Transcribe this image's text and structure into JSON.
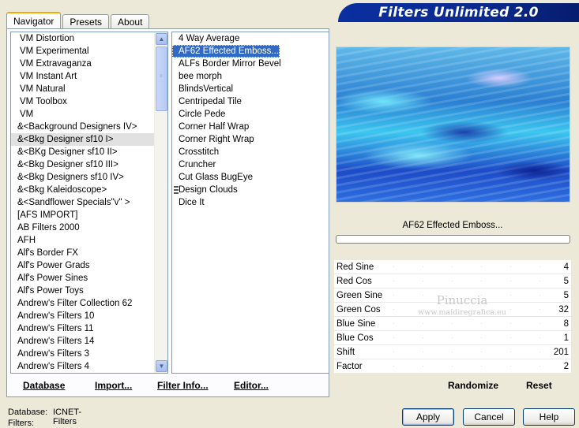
{
  "banner": {
    "title": "Filters Unlimited 2.0"
  },
  "tabs": [
    {
      "label": "Navigator"
    },
    {
      "label": "Presets"
    },
    {
      "label": "About"
    }
  ],
  "categories": [
    "VM Distortion",
    "VM Experimental",
    "VM Extravaganza",
    "VM Instant Art",
    "VM Natural",
    "VM Toolbox",
    "VM",
    "&<Background Designers IV>",
    "&<Bkg Designer sf10 I>",
    "&<BKg Designer sf10 II>",
    "&<Bkg Designer sf10 III>",
    "&<Bkg Designers sf10 IV>",
    "&<Bkg Kaleidoscope>",
    "&<Sandflower Specials\"v\" >",
    "[AFS IMPORT]",
    "AB Filters 2000",
    "AFH",
    "Alf's Border FX",
    "Alf's Power Grads",
    "Alf's Power Sines",
    "Alf's Power Toys",
    "Andrew's Filter Collection 62",
    "Andrew's Filters 10",
    "Andrew's Filters 11",
    "Andrew's Filters 14",
    "Andrew's Filters 3",
    "Andrew's Filters 4"
  ],
  "filters": [
    "4 Way Average",
    "AF62 Effected Emboss...",
    "ALFs Border Mirror Bevel",
    "bee morph",
    "BlindsVertical",
    "Centripedal Tile",
    "Circle Pede",
    "Corner Half Wrap",
    "Corner Right Wrap",
    "Crosstitch",
    "Cruncher",
    "Cut Glass  BugEye",
    "Design Clouds",
    "Dice It"
  ],
  "scroll": {
    "up": "▲",
    "down": "▼"
  },
  "left_buttons": {
    "database": "Database",
    "import": "Import...",
    "filter_info": "Filter Info...",
    "editor": "Editor..."
  },
  "preview": {
    "filter_name": "AF62 Effected Emboss..."
  },
  "params": [
    {
      "label": "Red Sine",
      "value": "4"
    },
    {
      "label": "Red Cos",
      "value": "5"
    },
    {
      "label": "Green Sine",
      "value": "5"
    },
    {
      "label": "Green Cos",
      "value": "32"
    },
    {
      "label": "Blue Sine",
      "value": "8"
    },
    {
      "label": "Blue Cos",
      "value": "1"
    },
    {
      "label": "Shift",
      "value": "201"
    },
    {
      "label": "Factor",
      "value": "2"
    }
  ],
  "right_buttons": {
    "randomize": "Randomize",
    "reset": "Reset"
  },
  "watermark": {
    "line1": "Pinuccia",
    "line2": "www.maidiregrafica.eu"
  },
  "status": {
    "database_label": "Database:",
    "database_value": "ICNET-Filters",
    "filters_label": "Filters:"
  },
  "dialog": {
    "apply": "Apply",
    "cancel": "Cancel",
    "help": "Help"
  }
}
